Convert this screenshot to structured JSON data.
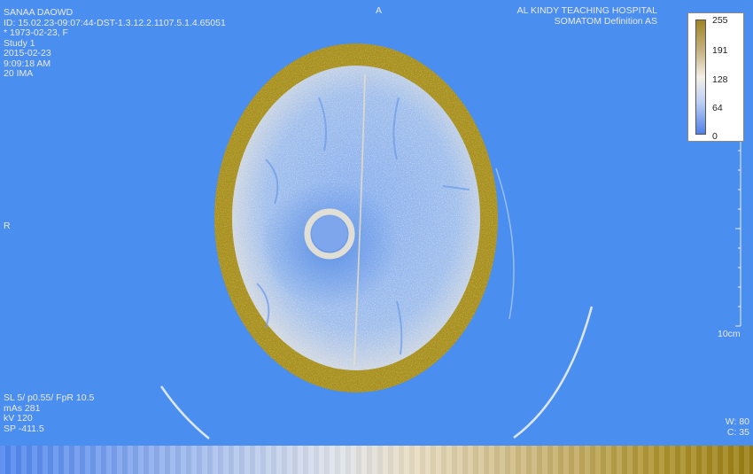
{
  "patient": {
    "name": "SANAA DAOWD",
    "id": "ID: 15.02.23-09:07:44-DST-1.3.12.2.1107.5.1.4.65051",
    "dob_sex": "* 1973-02-23, F",
    "study": "Study 1",
    "date": "2015-02-23",
    "time": "9:09:18 AM",
    "image": "20 IMA"
  },
  "institution": {
    "hospital": "AL KINDY TEACHING HOSPITAL",
    "scanner": "SOMATOM Definition AS"
  },
  "orientation": {
    "top": "A",
    "left": "R"
  },
  "acquisition": {
    "slice": "SL 5/ p0.55/ FpR 10.5",
    "mas": "mAs 281",
    "kv": "kV 120",
    "sp": "SP -411.5"
  },
  "window": {
    "width": "W: 80",
    "center": "C: 35"
  },
  "scale": {
    "label": "10cm"
  },
  "colorbar": {
    "ticks": [
      "255",
      "191",
      "128",
      "64",
      "0"
    ]
  },
  "colors": {
    "background": "#4a8ef0",
    "bone": "#a8901e",
    "brain_light": "#9cc0ee",
    "brain_dark": "#5d8fe4",
    "lesion_ring": "#e8e2d2"
  }
}
